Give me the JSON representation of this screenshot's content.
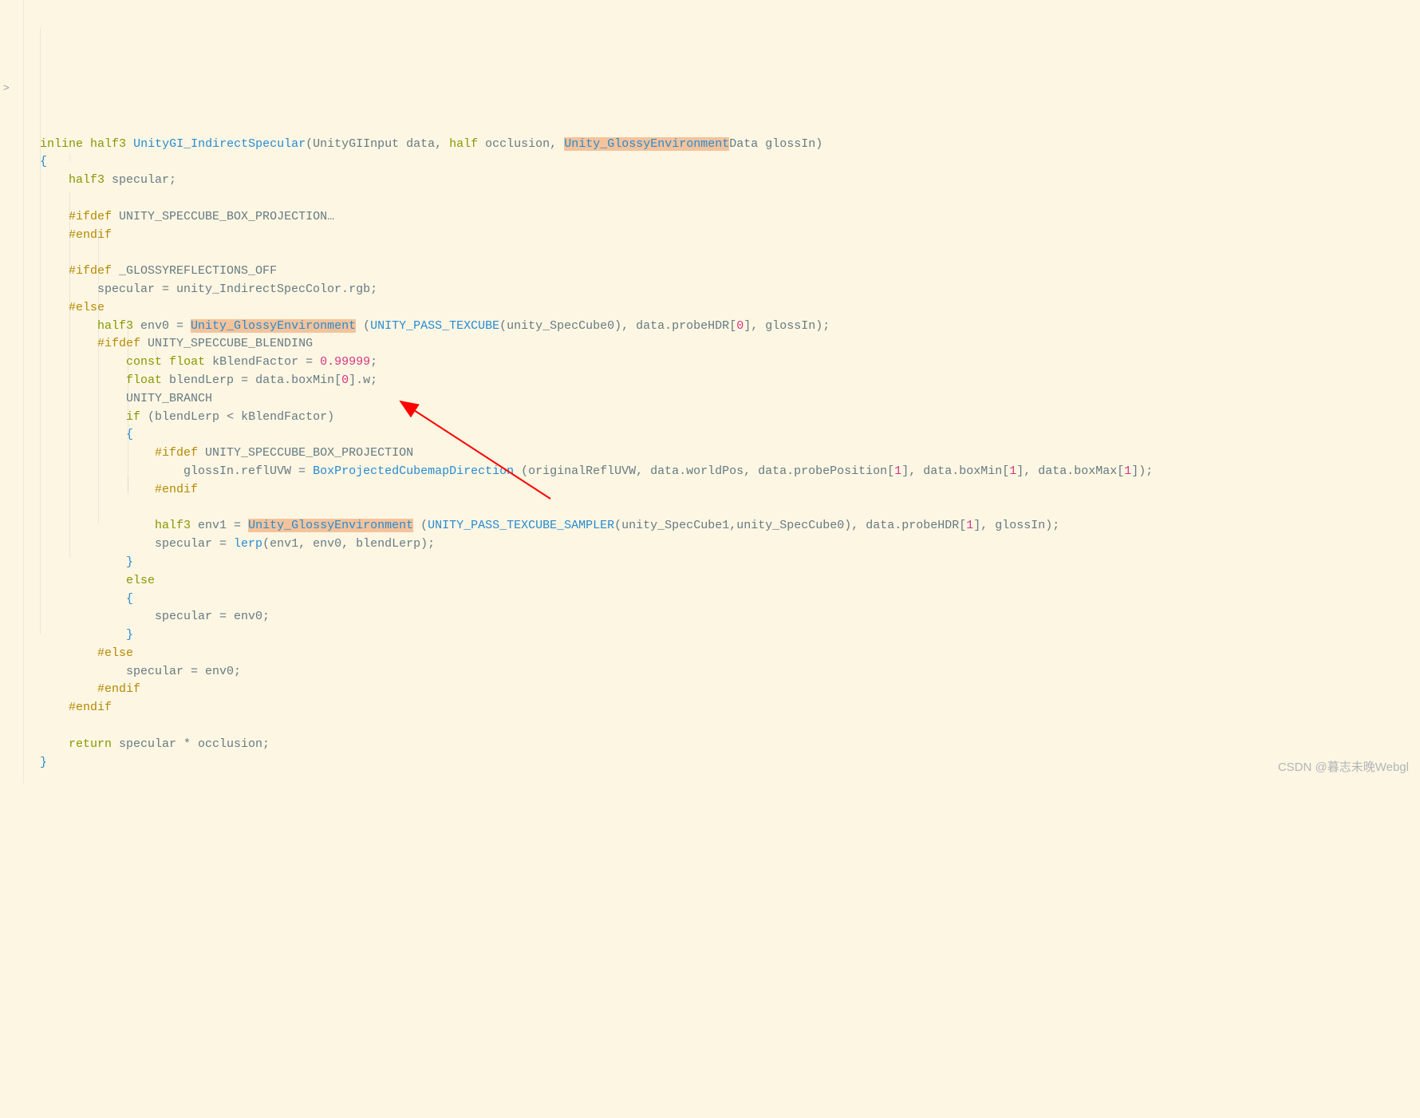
{
  "line1": {
    "inline": "inline",
    "half3": "half3",
    "fn": "UnityGI_IndirectSpecular",
    "params_a": "(UnityGIInput data, ",
    "half": "half",
    "params_b": " occlusion, ",
    "hl1": "Unity_GlossyEnvironment",
    "params_c": "Data glossIn)"
  },
  "line2": {
    "brace_open": "{"
  },
  "line3": {
    "half3": "half3",
    "rest": " specular;"
  },
  "line5": {
    "pp": "#ifdef",
    "rest": " UNITY_SPECCUBE_BOX_PROJECTION",
    "dots": "…"
  },
  "line6": {
    "pp": "#endif"
  },
  "line8": {
    "pp": "#ifdef",
    "rest": " _GLOSSYREFLECTIONS_OFF"
  },
  "line9": {
    "text": "        specular = unity_IndirectSpecColor.rgb;"
  },
  "line10": {
    "pp": "#else"
  },
  "line11": {
    "half3": "half3",
    "text1": " env0 = ",
    "hl": "Unity_GlossyEnvironment",
    "text2": " (",
    "fn": "UNITY_PASS_TEXCUBE",
    "text3": "(unity_SpecCube0), data.probeHDR[",
    "num": "0",
    "text4": "], glossIn);"
  },
  "line12": {
    "pp": "#ifdef",
    "rest": " UNITY_SPECCUBE_BLENDING"
  },
  "line13": {
    "const": "const",
    "float": "float",
    "text1": " kBlendFactor = ",
    "num": "0.99999",
    "text2": ";"
  },
  "line14": {
    "float": "float",
    "text1": " blendLerp = data.boxMin[",
    "num": "0",
    "text2": "].w;"
  },
  "line15": {
    "text": "            UNITY_BRANCH"
  },
  "line16": {
    "if": "if",
    "text": " (blendLerp < kBlendFactor)"
  },
  "line17": {
    "brace": "{"
  },
  "line18": {
    "pp": "#ifdef",
    "rest": " UNITY_SPECCUBE_BOX_PROJECTION"
  },
  "line19": {
    "text1": "                    glossIn.reflUVW = ",
    "fn": "BoxProjectedCubemapDirection",
    "text2": " (originalReflUVW, data.worldPos, data.probePosition[",
    "n1": "1",
    "text3": "], data.boxMin[",
    "n2": "1",
    "text4": "], data.boxMax[",
    "n3": "1",
    "text5": "]);"
  },
  "line20": {
    "pp": "#endif"
  },
  "line22": {
    "half3": "half3",
    "text1": " env1 = ",
    "hl": "Unity_GlossyEnvironment",
    "text2": " (",
    "fn": "UNITY_PASS_TEXCUBE_SAMPLER",
    "text3": "(unity_SpecCube1,unity_SpecCube0), data.probeHDR[",
    "num": "1",
    "text4": "], glossIn);"
  },
  "line23": {
    "text1": "                specular = ",
    "fn": "lerp",
    "text2": "(env1, env0, blendLerp);"
  },
  "line24": {
    "brace": "}"
  },
  "line25": {
    "else": "else"
  },
  "line26": {
    "brace": "{"
  },
  "line27": {
    "text": "                specular = env0;"
  },
  "line28": {
    "brace": "}"
  },
  "line29": {
    "pp": "#else"
  },
  "line30": {
    "text": "            specular = env0;"
  },
  "line31": {
    "pp": "#endif"
  },
  "line32": {
    "pp": "#endif"
  },
  "line34": {
    "return": "return",
    "text": " specular * occlusion;"
  },
  "line35": {
    "brace_close": "}"
  },
  "fold_marker": ">",
  "watermark": "CSDN @暮志未晚Webgl"
}
